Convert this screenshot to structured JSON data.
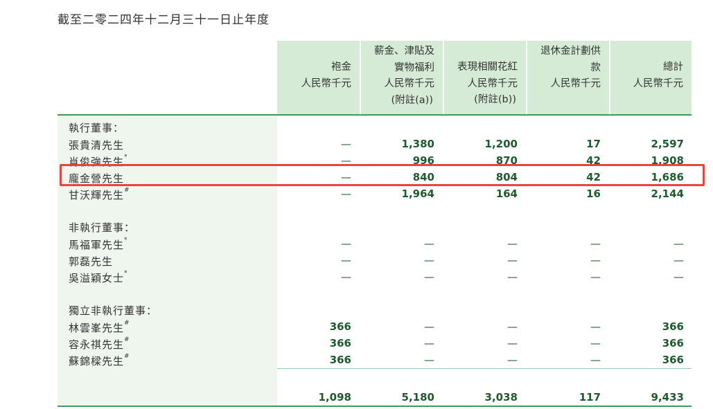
{
  "title": "截至二零二四年十二月三十一日止年度",
  "columns": [
    {
      "lines": [
        "袍金",
        "人民幣千元"
      ]
    },
    {
      "lines": [
        "薪金、津貼及",
        "實物福利",
        "人民幣千元",
        "(附註(a))"
      ]
    },
    {
      "lines": [
        "表現相關花紅",
        "人民幣千元",
        "(附註(b))"
      ]
    },
    {
      "lines": [
        "退休金計劃供",
        "款",
        "人民幣千元"
      ]
    },
    {
      "lines": [
        "總計",
        "人民幣千元"
      ]
    }
  ],
  "sections": [
    {
      "heading": "執行董事：",
      "rows": [
        {
          "name": "張貴清先生",
          "mark": "",
          "values": [
            "—",
            "1,380",
            "1,200",
            "17",
            "2,597"
          ]
        },
        {
          "name": "肖俊強先生",
          "mark": "*",
          "values": [
            "—",
            "996",
            "870",
            "42",
            "1,908"
          ]
        },
        {
          "name": "龐金營先生",
          "mark": "",
          "values": [
            "—",
            "840",
            "804",
            "42",
            "1,686"
          ]
        },
        {
          "name": "甘沃輝先生",
          "mark": "#",
          "values": [
            "—",
            "1,964",
            "164",
            "16",
            "2,144"
          ]
        }
      ]
    },
    {
      "heading": "非執行董事：",
      "rows": [
        {
          "name": "馬福軍先生",
          "mark": "*",
          "values": [
            "—",
            "—",
            "—",
            "—",
            "—"
          ]
        },
        {
          "name": "郭磊先生",
          "mark": "",
          "values": [
            "—",
            "—",
            "—",
            "—",
            "—"
          ]
        },
        {
          "name": "吳溢穎女士",
          "mark": "*",
          "values": [
            "—",
            "—",
            "—",
            "—",
            "—"
          ]
        }
      ]
    },
    {
      "heading": "獨立非執行董事：",
      "rows": [
        {
          "name": "林雲峯先生",
          "mark": "#",
          "values": [
            "366",
            "—",
            "—",
            "—",
            "366"
          ]
        },
        {
          "name": "容永祺先生",
          "mark": "#",
          "values": [
            "366",
            "—",
            "—",
            "—",
            "366"
          ]
        },
        {
          "name": "蘇錦樑先生",
          "mark": "#",
          "values": [
            "366",
            "—",
            "—",
            "—",
            "366"
          ]
        }
      ]
    }
  ],
  "totals": [
    "1,098",
    "5,180",
    "3,038",
    "117",
    "9,433"
  ],
  "highlight_color": "#e8453c",
  "header_bg": "#d6ebd5",
  "value_color": "#1f5a2e"
}
